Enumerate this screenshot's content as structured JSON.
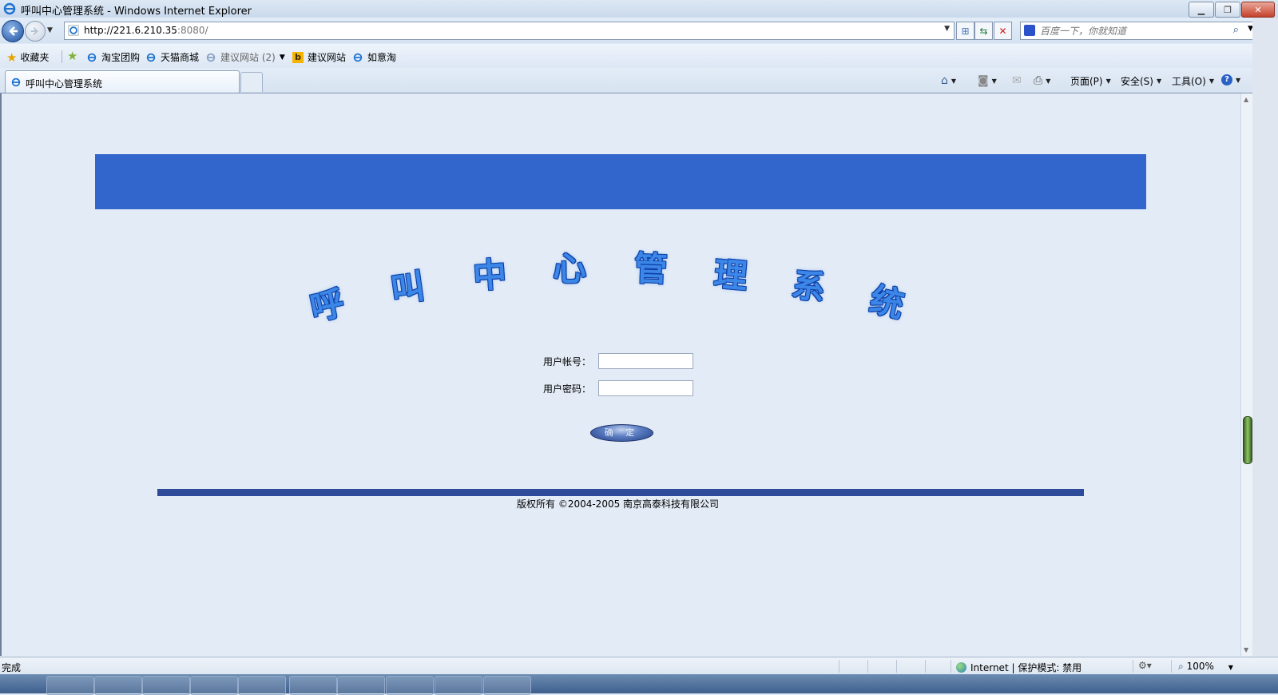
{
  "window": {
    "title": "呼叫中心管理系统 - Windows Internet Explorer"
  },
  "address_bar": {
    "url_host": "http://221.6.210.35",
    "url_port": ":8080/"
  },
  "search": {
    "placeholder": "百度一下，你就知道"
  },
  "favorites_bar": {
    "favorites_label": "收藏夹",
    "items": [
      {
        "label": "淘宝团购"
      },
      {
        "label": "天猫商城"
      },
      {
        "label": "建议网站 (2)"
      },
      {
        "label": "建议网站"
      },
      {
        "label": "如意淘"
      }
    ]
  },
  "tabs": [
    {
      "label": "呼叫中心管理系统"
    }
  ],
  "command_bar": {
    "page": "页面(P)",
    "safety": "安全(S)",
    "tools": "工具(O)"
  },
  "page": {
    "heading_chars": [
      "呼",
      "叫",
      "中",
      "心",
      "管",
      "理",
      "系",
      "统"
    ],
    "account_label": "用户帐号：",
    "password_label": "用户密码：",
    "account_value": "",
    "password_value": "",
    "login_button": "确 定",
    "copyright": "版权所有 ©2004-2005 南京高泰科技有限公司",
    "banner_color": "#3366cc",
    "footer_bar_color": "#2e4b9a"
  },
  "status_bar": {
    "status": "完成",
    "zone": "Internet | 保护模式: 禁用",
    "zoom": "100%"
  }
}
